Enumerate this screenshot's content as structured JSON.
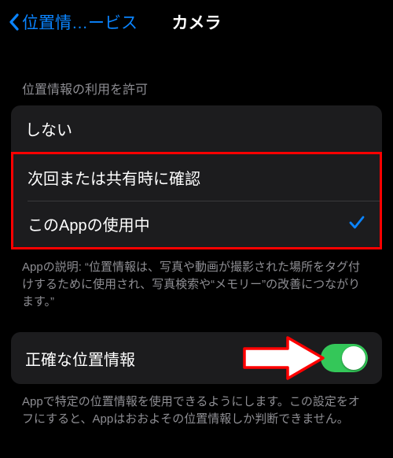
{
  "nav": {
    "back_label": "位置情…ービス",
    "title": "カメラ"
  },
  "section1": {
    "header": "位置情報の利用を許可",
    "options": [
      {
        "label": "しない",
        "selected": false
      },
      {
        "label": "次回または共有時に確認",
        "selected": false
      },
      {
        "label": "このAppの使用中",
        "selected": true
      }
    ],
    "footer": "Appの説明: “位置情報は、写真や動画が撮影された場所をタグ付けするために使用され、写真検索や“メモリー”の改善につながります。”"
  },
  "section2": {
    "label": "正確な位置情報",
    "toggle_on": true,
    "footer": "Appで特定の位置情報を使用できるようにします。この設定をオフにすると、Appはおおよその位置情報しか判断できません。"
  },
  "colors": {
    "accent": "#0a84ff",
    "switch_on": "#34c759",
    "highlight": "#ff0000"
  }
}
